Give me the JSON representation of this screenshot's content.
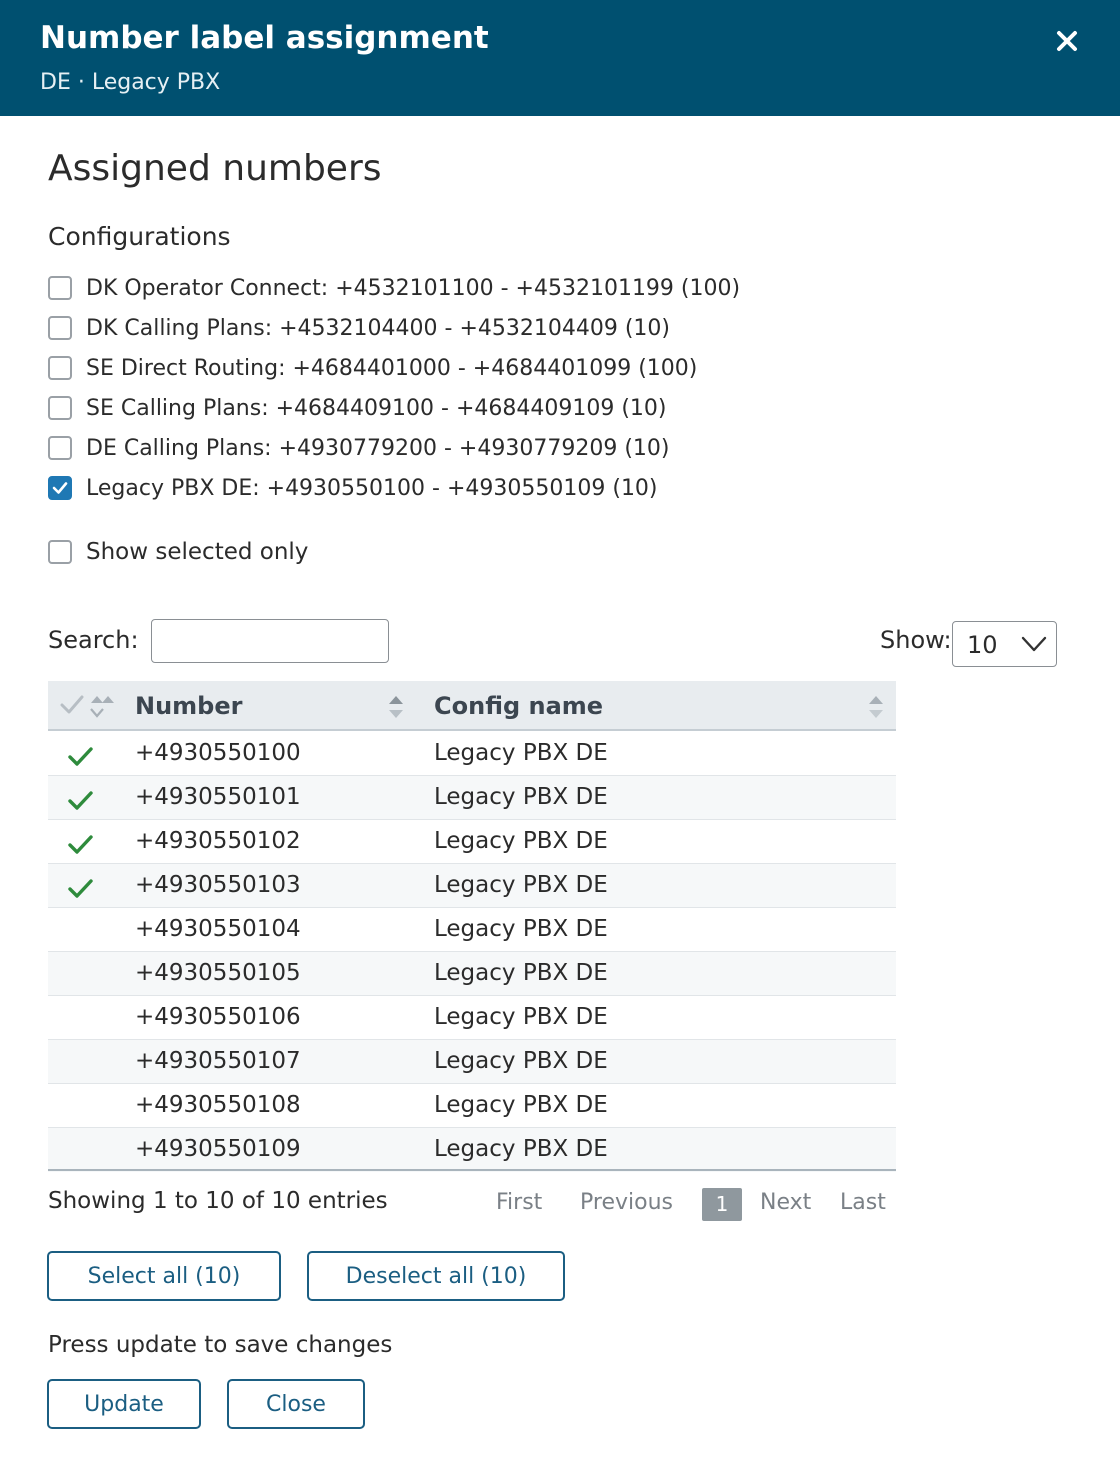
{
  "header": {
    "title": "Number label assignment",
    "subtitle": "DE · Legacy PBX"
  },
  "main": {
    "title": "Assigned numbers",
    "configurations_title": "Configurations",
    "configurations": [
      {
        "label": "DK Operator Connect: +4532101100 - +4532101199 (100)",
        "checked": false
      },
      {
        "label": "DK Calling Plans: +4532104400 - +4532104409 (10)",
        "checked": false
      },
      {
        "label": "SE Direct Routing: +4684401000 - +4684401099 (100)",
        "checked": false
      },
      {
        "label": "SE Calling Plans: +4684409100 - +4684409109 (10)",
        "checked": false
      },
      {
        "label": "DE Calling Plans: +4930779200 - +4930779209 (10)",
        "checked": false
      },
      {
        "label": "Legacy PBX DE: +4930550100 - +4930550109 (10)",
        "checked": true
      }
    ],
    "show_selected_only": {
      "label": "Show selected only",
      "checked": false
    }
  },
  "table_controls": {
    "search_label": "Search:",
    "search_value": "",
    "show_label": "Show:",
    "show_value": "10"
  },
  "table": {
    "columns": [
      "Number",
      "Config name"
    ],
    "rows": [
      {
        "number": "+4930550100",
        "config": "Legacy PBX DE",
        "selected": true
      },
      {
        "number": "+4930550101",
        "config": "Legacy PBX DE",
        "selected": true
      },
      {
        "number": "+4930550102",
        "config": "Legacy PBX DE",
        "selected": true
      },
      {
        "number": "+4930550103",
        "config": "Legacy PBX DE",
        "selected": true
      },
      {
        "number": "+4930550104",
        "config": "Legacy PBX DE",
        "selected": false
      },
      {
        "number": "+4930550105",
        "config": "Legacy PBX DE",
        "selected": false
      },
      {
        "number": "+4930550106",
        "config": "Legacy PBX DE",
        "selected": false
      },
      {
        "number": "+4930550107",
        "config": "Legacy PBX DE",
        "selected": false
      },
      {
        "number": "+4930550108",
        "config": "Legacy PBX DE",
        "selected": false
      },
      {
        "number": "+4930550109",
        "config": "Legacy PBX DE",
        "selected": false
      }
    ]
  },
  "pagination": {
    "info": "Showing 1 to 10 of 10 entries",
    "first": "First",
    "previous": "Previous",
    "current": "1",
    "next": "Next",
    "last": "Last"
  },
  "actions": {
    "select_all": "Select all (10)",
    "deselect_all": "Deselect all (10)",
    "note": "Press update to save changes",
    "update": "Update",
    "close": "Close"
  },
  "colors": {
    "header_bg": "#005070",
    "accent": "#1f78b4",
    "check_green": "#2e8b3c"
  }
}
